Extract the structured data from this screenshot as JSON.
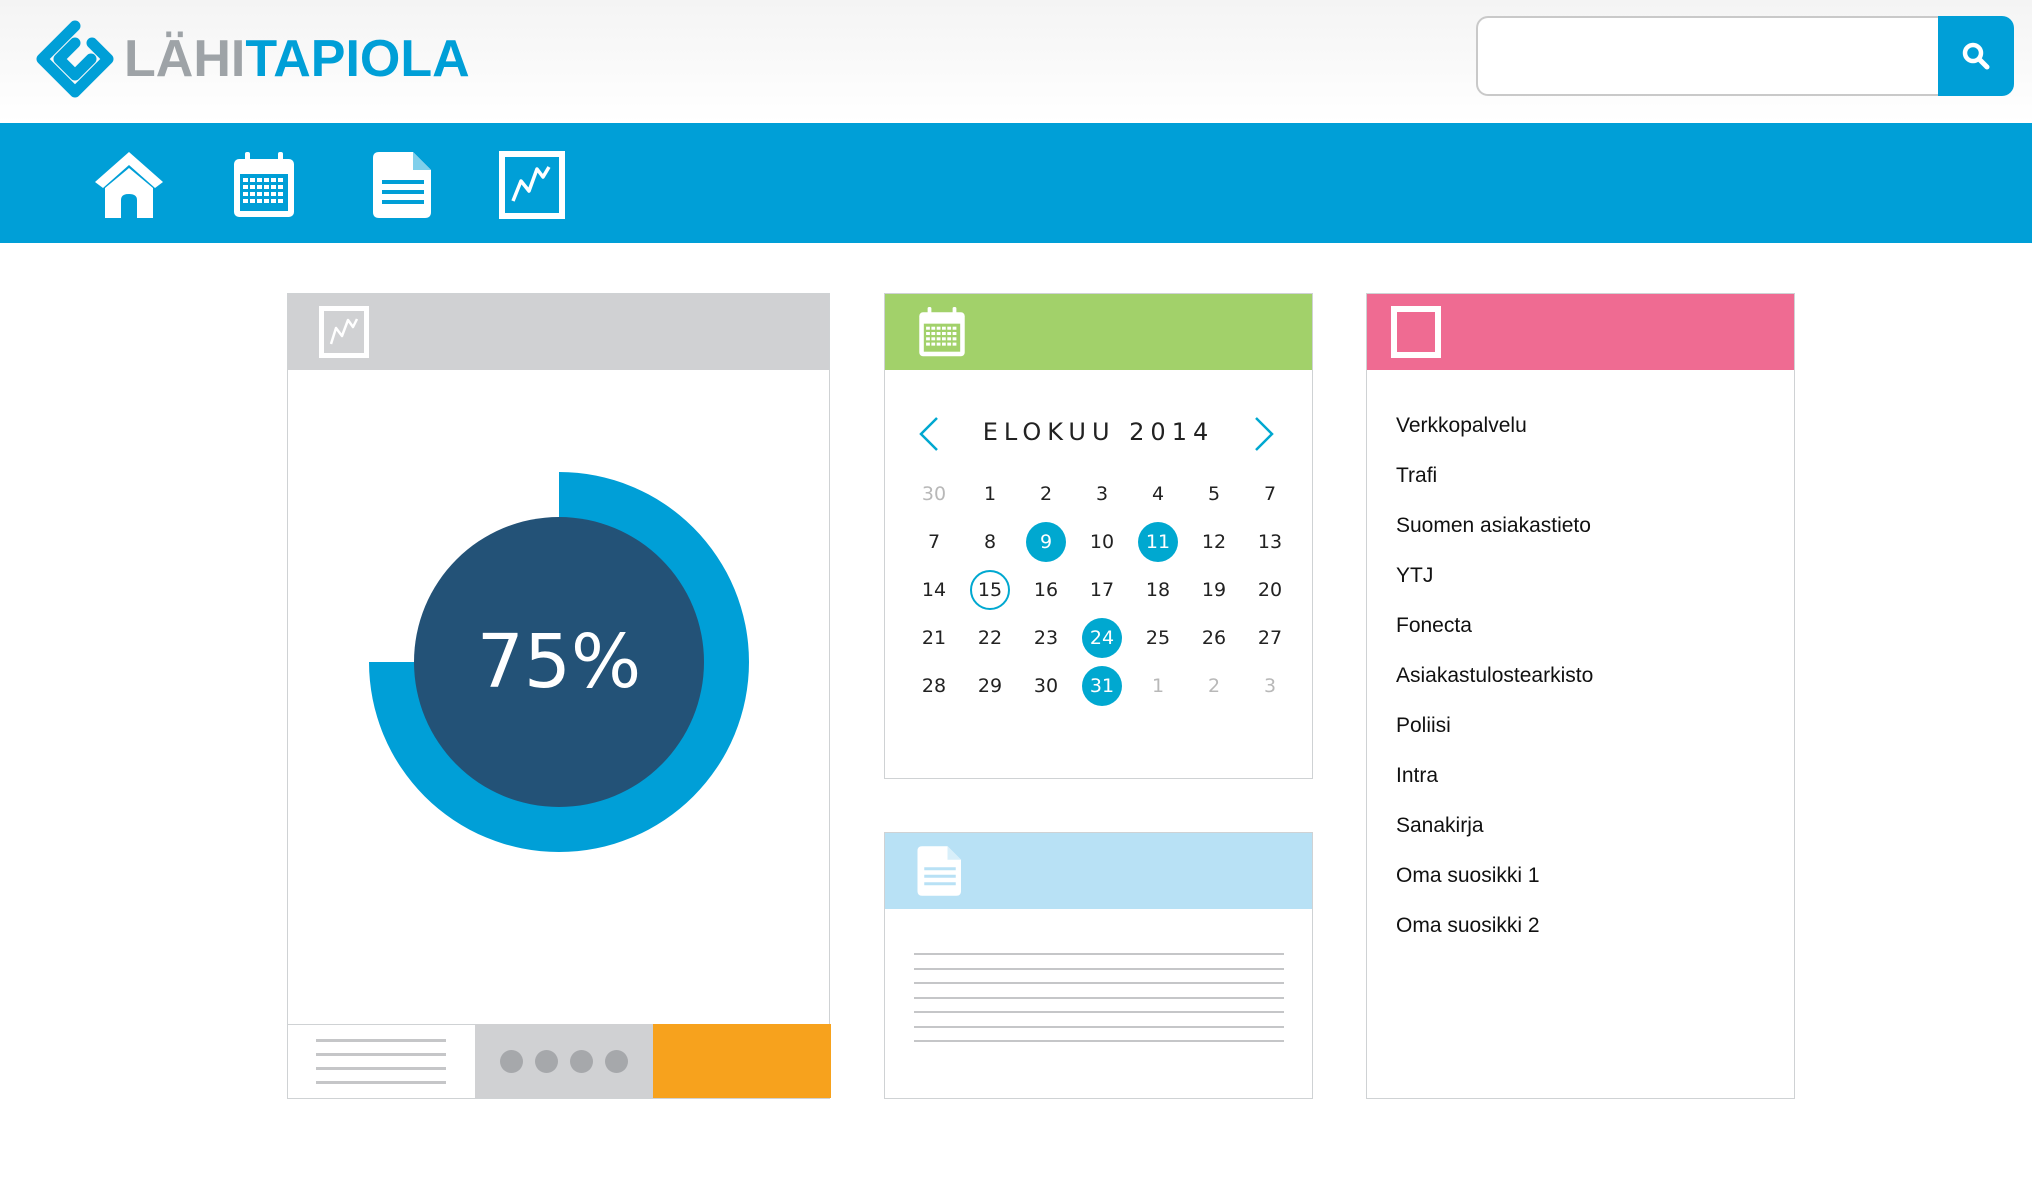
{
  "brand": {
    "part1": "LÄHI",
    "part2": "TAPIOLA",
    "color_gray": "#9ea3a7",
    "color_blue": "#009fd7"
  },
  "search": {
    "value": "",
    "button_icon": "magnifier-icon"
  },
  "nav": {
    "items": [
      {
        "icon": "home-icon"
      },
      {
        "icon": "calendar-icon"
      },
      {
        "icon": "document-icon"
      },
      {
        "icon": "chart-icon"
      }
    ],
    "color": "#009fd7"
  },
  "chart_card": {
    "header_color": "#d0d1d3",
    "header_icon": "chart-icon",
    "progress_label": "75%",
    "progress_value": 0.75,
    "ring_color": "#009fd7",
    "center_color": "#235277",
    "footer_colors": [
      "#ffffff",
      "#d0d1d3",
      "#f7a21d"
    ]
  },
  "calendar": {
    "header_color": "#a2d16a",
    "header_icon": "calendar-icon",
    "title": "ELOKUU 2014",
    "accent": "#00a8d0",
    "weeks": [
      [
        {
          "d": "30",
          "dim": true
        },
        {
          "d": "1"
        },
        {
          "d": "2"
        },
        {
          "d": "3"
        },
        {
          "d": "4"
        },
        {
          "d": "5"
        },
        {
          "d": "7"
        }
      ],
      [
        {
          "d": "7"
        },
        {
          "d": "8"
        },
        {
          "d": "9",
          "sel": true
        },
        {
          "d": "10"
        },
        {
          "d": "11",
          "sel": true
        },
        {
          "d": "12"
        },
        {
          "d": "13"
        }
      ],
      [
        {
          "d": "14"
        },
        {
          "d": "15",
          "today": true
        },
        {
          "d": "16"
        },
        {
          "d": "17"
        },
        {
          "d": "18"
        },
        {
          "d": "19"
        },
        {
          "d": "20"
        }
      ],
      [
        {
          "d": "21"
        },
        {
          "d": "22"
        },
        {
          "d": "23"
        },
        {
          "d": "24",
          "sel": true
        },
        {
          "d": "25"
        },
        {
          "d": "26"
        },
        {
          "d": "27"
        }
      ],
      [
        {
          "d": "28"
        },
        {
          "d": "29"
        },
        {
          "d": "30"
        },
        {
          "d": "31",
          "sel": true
        },
        {
          "d": "1",
          "dim": true
        },
        {
          "d": "2",
          "dim": true
        },
        {
          "d": "3",
          "dim": true
        }
      ]
    ]
  },
  "document_card": {
    "header_color": "#b8e1f5",
    "header_icon": "document-icon"
  },
  "links_card": {
    "header_color": "#ef6b92",
    "header_icon": "square-icon",
    "items": [
      "Verkkopalvelu",
      "Trafi",
      "Suomen asiakastieto",
      "YTJ",
      "Fonecta",
      "Asiakastulostearkisto",
      "Poliisi",
      "Intra",
      "Sanakirja",
      "Oma suosikki 1",
      "Oma suosikki 2"
    ]
  }
}
